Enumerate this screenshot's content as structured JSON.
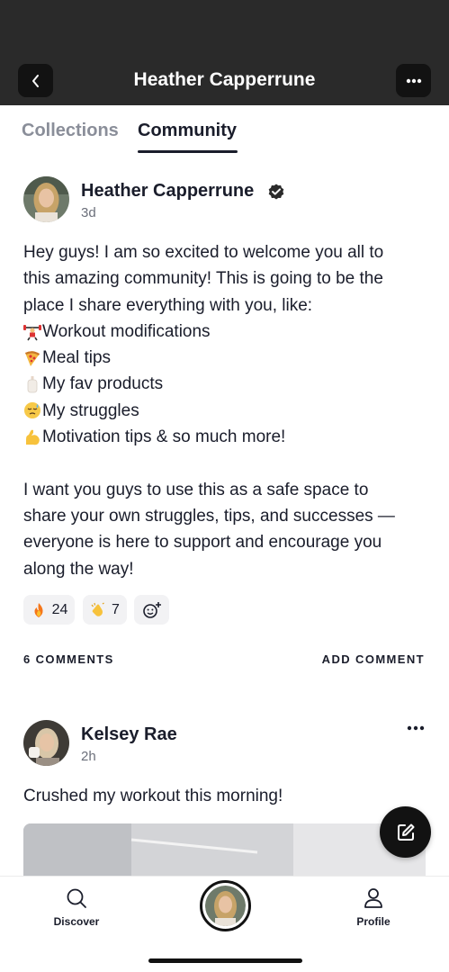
{
  "header": {
    "title": "Heather Capperrune",
    "back_icon": "chevron-left-icon",
    "more_icon": "more-horizontal-icon"
  },
  "tabs": [
    {
      "label": "Collections",
      "active": false
    },
    {
      "label": "Community",
      "active": true
    }
  ],
  "post": {
    "author": "Heather Capperrune",
    "verified": true,
    "time": "3d",
    "lines": [
      {
        "emoji": "",
        "text": "Hey guys! I am so excited to welcome you all to"
      },
      {
        "emoji": "",
        "text": "this amazing community! This is going to be the"
      },
      {
        "emoji": "",
        "text": "place I share everything with you, like:"
      },
      {
        "emoji": "weightlifter-emoji",
        "text": "Workout modifications"
      },
      {
        "emoji": "pizza-emoji",
        "text": "Meal tips"
      },
      {
        "emoji": "lotion-bottle-emoji",
        "text": "My fav products"
      },
      {
        "emoji": "downcast-sweat-emoji",
        "text": "My struggles"
      },
      {
        "emoji": "flexed-biceps-emoji",
        "text": "Motivation tips & so much more!"
      },
      {
        "emoji": "",
        "text": ""
      },
      {
        "emoji": "",
        "text": "I want you guys to use this as a safe space to"
      },
      {
        "emoji": "",
        "text": "share your own struggles, tips, and successes —"
      },
      {
        "emoji": "",
        "text": "everyone is here to support and encourage you"
      },
      {
        "emoji": "",
        "text": "along the way!"
      }
    ],
    "reactions": [
      {
        "icon": "fire-emoji",
        "count": "24"
      },
      {
        "icon": "clapping-hands-emoji",
        "count": "7"
      },
      {
        "icon": "add-reaction-icon",
        "count": ""
      }
    ],
    "comments_label": "6 COMMENTS",
    "add_comment_label": "ADD COMMENT"
  },
  "comment_post": {
    "author": "Kelsey Rae",
    "time": "2h",
    "text": "Crushed my workout this morning!",
    "more_icon": "more-horizontal-icon"
  },
  "fab": {
    "icon": "compose-icon"
  },
  "bottom_nav": {
    "discover": {
      "label": "Discover",
      "icon": "search-icon"
    },
    "center": {
      "icon": "profile-avatar"
    },
    "profile": {
      "label": "Profile",
      "icon": "user-icon"
    }
  },
  "colors": {
    "header_bg": "#2a2a2a",
    "button_bg": "#121212",
    "text_primary": "#1a1d2b",
    "text_muted": "#8a8e99",
    "reaction_bg": "#f2f2f4"
  }
}
